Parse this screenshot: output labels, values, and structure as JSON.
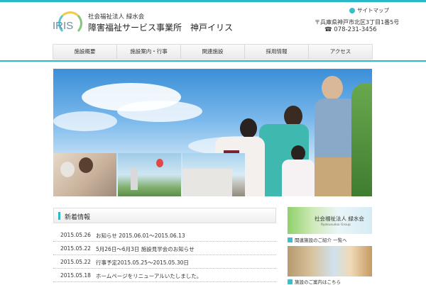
{
  "header": {
    "logo_text": "IRIS",
    "org": "社会福祉法人 緑水会",
    "name": "障害福祉サービス事業所　神戸イリス",
    "sitemap": "サイトマップ",
    "address": "〒兵庫県神戸市北区3丁目1番5号",
    "tel": "☎ 078-231-3456"
  },
  "nav": [
    "施設概要",
    "施設案内・行事",
    "関連施設",
    "採用情報",
    "アクセス"
  ],
  "news": {
    "title": "新着情報",
    "items": [
      {
        "date": "2015.05.26",
        "text": "お知らせ 2015.06.01～2015.06.13"
      },
      {
        "date": "2015.05.22",
        "text": "5月26日～6月3日 施設見学会のお知らせ"
      },
      {
        "date": "2015.05.22",
        "text": "行事予定2015.05.25～2015.05.30日"
      },
      {
        "date": "2015.05.18",
        "text": "ホームページをリニューアルいたしました。"
      }
    ]
  },
  "side": {
    "banner_title": "社会福祉法人 緑水会",
    "banner_sub": "Ryokusuikai Group",
    "link1": "関連施設のご紹介 一覧へ",
    "link2": "施設のご案内はこちら"
  },
  "colors": {
    "accent": "#2bb9c9"
  }
}
